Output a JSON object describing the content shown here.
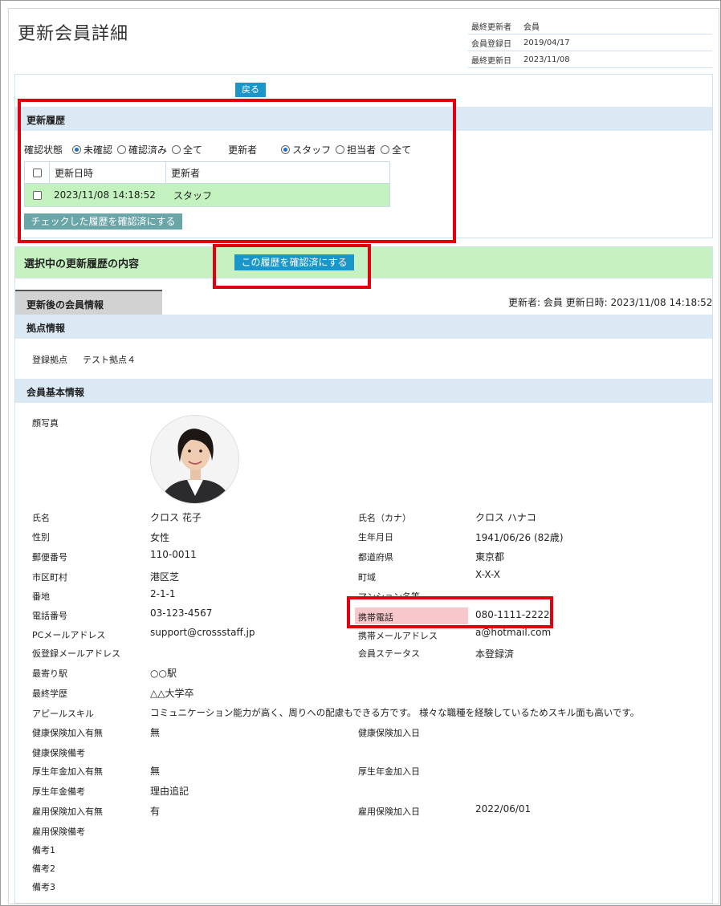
{
  "page": {
    "title": "更新会員詳細",
    "meta": [
      {
        "label": "最終更新者",
        "value": "会員"
      },
      {
        "label": "会員登録日",
        "value": "2019/04/17"
      },
      {
        "label": "最終更新日",
        "value": "2023/11/08"
      }
    ],
    "back_button": "戻る"
  },
  "history": {
    "section_title": "更新履歴",
    "status_label": "確認状態",
    "status_options": [
      "未確認",
      "確認済み",
      "全て"
    ],
    "status_selected": "未確認",
    "updater_label": "更新者",
    "updater_options": [
      "スタッフ",
      "担当者",
      "全て"
    ],
    "updater_selected": "スタッフ",
    "table_headers": [
      "更新日時",
      "更新者"
    ],
    "rows": [
      {
        "datetime": "2023/11/08 14:18:52",
        "updater": "スタッフ"
      }
    ],
    "confirm_checked_button": "チェックした履歴を確認済にする"
  },
  "selected": {
    "title": "選択中の更新履歴の内容",
    "confirm_button": "この履歴を確認済にする",
    "tab_after": "更新後の会員情報",
    "updated_info": "更新者: 会員  更新日時: 2023/11/08 14:18:52"
  },
  "base": {
    "section_title": "拠点情報",
    "reg_label": "登録拠点",
    "reg_value": "テスト拠点４"
  },
  "member": {
    "section_title": "会員基本情報",
    "photo_label": "顔写真",
    "fields": {
      "name_label": "氏名",
      "name": "クロス 花子",
      "kana_label": "氏名（カナ）",
      "kana": "クロス ハナコ",
      "gender_label": "性別",
      "gender": "女性",
      "birth_label": "生年月日",
      "birth": "1941/06/26 (82歳)",
      "zip_label": "郵便番号",
      "zip": "110-0011",
      "pref_label": "都道府県",
      "pref": "東京都",
      "city_label": "市区町村",
      "city": "港区芝",
      "town_label": "町域",
      "town": "X-X-X",
      "addr_label": "番地",
      "addr": "2-1-1",
      "mansion_label": "マンション名等",
      "tel_label": "電話番号",
      "tel": "03-123-4567",
      "mobile_label": "携帯電話",
      "mobile": "080-1111-2222",
      "pcmail_label": "PCメールアドレス",
      "pcmail": "support@crossstaff.jp",
      "mobilemail_label": "携帯メールアドレス",
      "mobilemail": "a@hotmail.com",
      "tempmail_label": "仮登録メールアドレス",
      "status_label": "会員ステータス",
      "status": "本登録済",
      "station_label": "最寄り駅",
      "station": "○○駅",
      "edu_label": "最終学歴",
      "edu": "△△大学卒",
      "skill_label": "アピールスキル",
      "skill": "コミュニケーション能力が高く、周りへの配慮もできる方です。 様々な職種を経験しているためスキル面も高いです。",
      "health_label": "健康保険加入有無",
      "health": "無",
      "health_date_label": "健康保険加入日",
      "health_note_label": "健康保険備考",
      "pension_label": "厚生年金加入有無",
      "pension": "無",
      "pension_date_label": "厚生年金加入日",
      "pension_note_label": "厚生年金備考",
      "pension_note": "理由追記",
      "emp_label": "雇用保険加入有無",
      "emp": "有",
      "emp_date_label": "雇用保険加入日",
      "emp_date": "2022/06/01",
      "emp_note_label": "雇用保険備考",
      "note1_label": "備考1",
      "note2_label": "備考2",
      "note3_label": "備考3"
    }
  }
}
